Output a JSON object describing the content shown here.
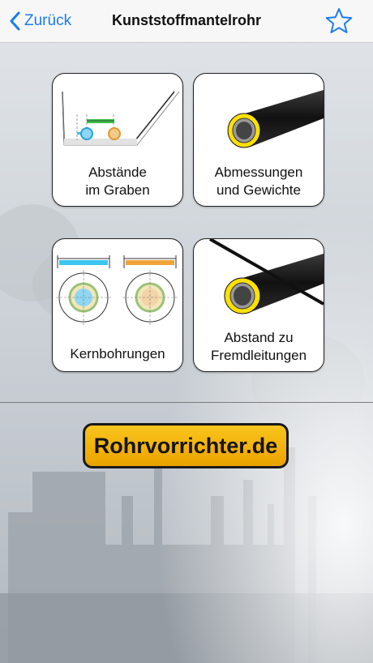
{
  "nav": {
    "back_label": "Zurück",
    "title": "Kunststoffmantelrohr",
    "favorite_icon": "star-outline-icon"
  },
  "tiles": [
    {
      "label_line1": "Abstände",
      "label_line2": "im Graben",
      "icon": "trench-spacing-icon"
    },
    {
      "label_line1": "Abmessungen",
      "label_line2": "und Gewichte",
      "icon": "insulated-pipe-icon"
    },
    {
      "label_line1": "Kernbohrungen",
      "label_line2": "",
      "icon": "core-drilling-icon"
    },
    {
      "label_line1": "Abstand zu",
      "label_line2": "Fremdleitungen",
      "icon": "pipe-distance-icon"
    }
  ],
  "brand": {
    "label": "Rohrvorrichter.de"
  },
  "colors": {
    "accent": "#1a7cf2",
    "brand_yellow": "#f5b40f",
    "cyan": "#39c6f0",
    "orange": "#f0a43a",
    "green": "#3dc24a"
  }
}
